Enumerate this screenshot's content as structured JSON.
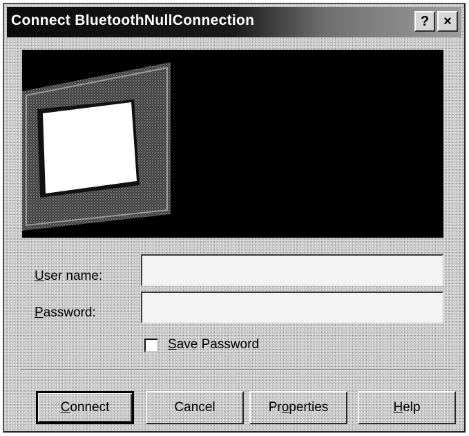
{
  "window": {
    "title": "Connect BluetoothNullConnection",
    "help_button": "?",
    "close_button": "×"
  },
  "banner": {
    "description_icon": "monitor-screen-graphic"
  },
  "form": {
    "username": {
      "label_accel": "U",
      "label_rest": "ser name:",
      "value": ""
    },
    "password": {
      "label_accel": "P",
      "label_rest": "assword:",
      "value": ""
    },
    "save_password": {
      "label_accel": "S",
      "label_rest": "ave Password",
      "checked": false
    }
  },
  "buttons": {
    "connect": {
      "accel": "C",
      "rest": "onnect"
    },
    "cancel": {
      "label": "Cancel"
    },
    "properties": {
      "pre": "Pr",
      "accel": "o",
      "rest": "perties"
    },
    "help": {
      "accel": "H",
      "rest": "elp"
    }
  },
  "colors": {
    "title_bar": "#151515",
    "dialog_face": "#c8c8c8",
    "banner_bg": "#000000"
  }
}
